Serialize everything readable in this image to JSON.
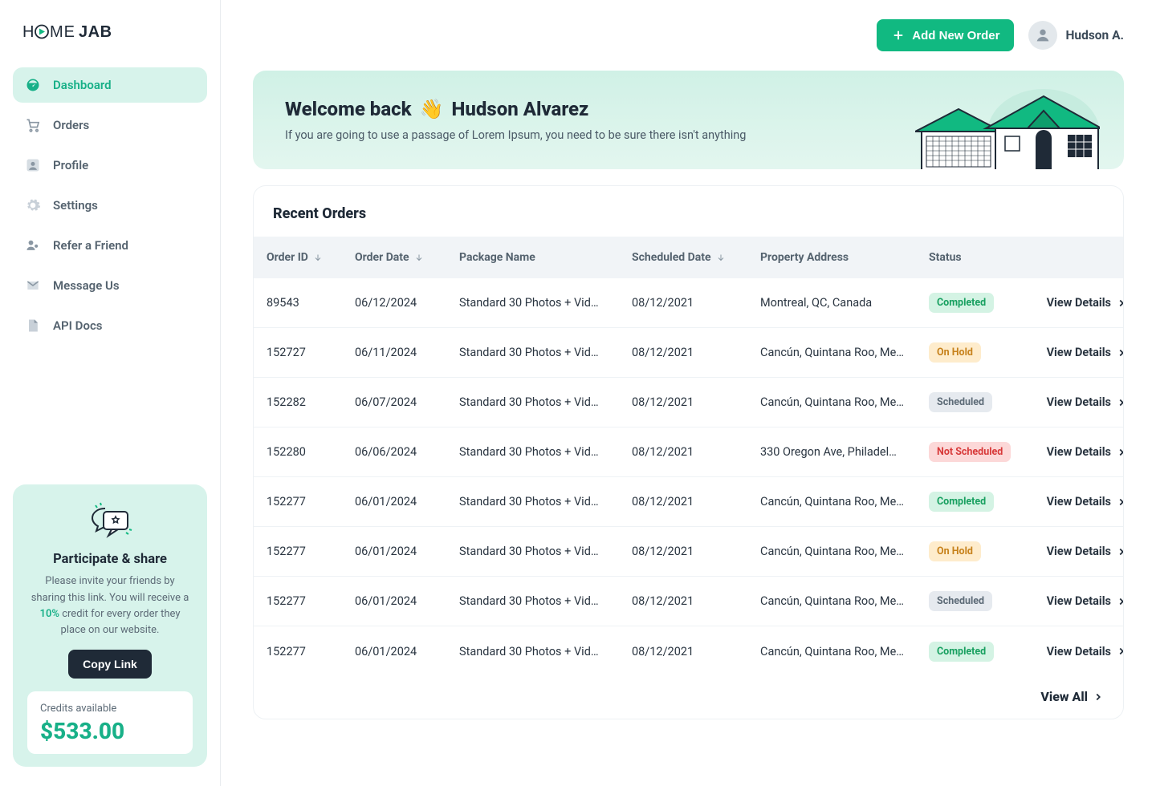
{
  "brand": {
    "name": "HOMEJAB"
  },
  "sidebar": {
    "items": [
      {
        "label": "Dashboard"
      },
      {
        "label": "Orders"
      },
      {
        "label": "Profile"
      },
      {
        "label": "Settings"
      },
      {
        "label": "Refer a Friend"
      },
      {
        "label": "Message Us"
      },
      {
        "label": "API Docs"
      }
    ]
  },
  "promo": {
    "title": "Participate & share",
    "body_before": "Please invite your friends by sharing this link. You will receive a ",
    "accent": "10%",
    "body_after": " credit for every order they place on our website.",
    "cta": "Copy Link",
    "credits_label": "Credits available",
    "credits_value": "$533.00"
  },
  "header": {
    "add_label": "Add New Order",
    "user_name": "Hudson A."
  },
  "welcome": {
    "greeting_prefix": "Welcome back",
    "emoji": "👋",
    "name": "Hudson Alvarez",
    "subtitle": "If you are going to use a passage of Lorem Ipsum, you need to be sure there isn't anything"
  },
  "orders": {
    "title": "Recent Orders",
    "columns": [
      "Order ID",
      "Order Date",
      "Package Name",
      "Scheduled Date",
      "Property Address",
      "Status"
    ],
    "view_details_label": "View Details",
    "view_all_label": "View All",
    "rows": [
      {
        "id": "89543",
        "date": "06/12/2024",
        "pkg": "Standard 30 Photos + Vid…",
        "sched": "08/12/2021",
        "addr": "Montreal, QC, Canada",
        "status": "Completed"
      },
      {
        "id": "152727",
        "date": "06/11/2024",
        "pkg": "Standard 30 Photos + Vid…",
        "sched": "08/12/2021",
        "addr": "Cancún, Quintana Roo, Me…",
        "status": "On Hold"
      },
      {
        "id": "152282",
        "date": "06/07/2024",
        "pkg": "Standard 30 Photos + Vid…",
        "sched": "08/12/2021",
        "addr": "Cancún, Quintana Roo, Me…",
        "status": "Scheduled"
      },
      {
        "id": "152280",
        "date": "06/06/2024",
        "pkg": "Standard 30 Photos + Vid…",
        "sched": "08/12/2021",
        "addr": "330 Oregon Ave, Philadel…",
        "status": "Not Scheduled"
      },
      {
        "id": "152277",
        "date": "06/01/2024",
        "pkg": "Standard 30 Photos + Vid…",
        "sched": "08/12/2021",
        "addr": "Cancún, Quintana Roo, Me…",
        "status": "Completed"
      },
      {
        "id": "152277",
        "date": "06/01/2024",
        "pkg": "Standard 30 Photos + Vid…",
        "sched": "08/12/2021",
        "addr": "Cancún, Quintana Roo, Me…",
        "status": "On Hold"
      },
      {
        "id": "152277",
        "date": "06/01/2024",
        "pkg": "Standard 30 Photos + Vid…",
        "sched": "08/12/2021",
        "addr": "Cancún, Quintana Roo, Me…",
        "status": "Scheduled"
      },
      {
        "id": "152277",
        "date": "06/01/2024",
        "pkg": "Standard 30 Photos + Vid…",
        "sched": "08/12/2021",
        "addr": "Cancún, Quintana Roo, Me…",
        "status": "Completed"
      }
    ]
  },
  "colors": {
    "accent": "#11b981",
    "status": {
      "Completed": "#18a060",
      "On Hold": "#c7821c",
      "Scheduled": "#5d6b77",
      "Not Scheduled": "#d83a3a"
    }
  }
}
